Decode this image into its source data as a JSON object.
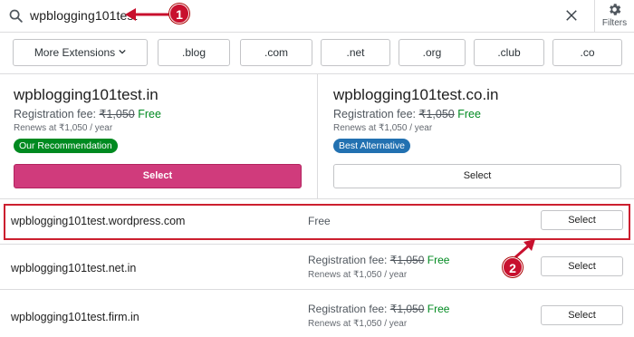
{
  "search": {
    "query": "wpblogging101test",
    "filters_label": "Filters"
  },
  "annotations": {
    "step1": "1",
    "step2": "2",
    "marker_color": "#c8102e"
  },
  "extensions": {
    "more_label": "More Extensions",
    "items": [
      ".blog",
      ".com",
      ".net",
      ".org",
      ".club",
      ".co"
    ]
  },
  "featured": [
    {
      "domain": "wpblogging101test.in",
      "fee_label": "Registration fee:",
      "old_price": "₹1,050",
      "price": "Free",
      "renews": "Renews at ₹1,050 / year",
      "badge": "Our Recommendation",
      "badge_color": "#008a20",
      "select_label": "Select",
      "select_color": "#d52c82"
    },
    {
      "domain": "wpblogging101test.co.in",
      "fee_label": "Registration fee:",
      "old_price": "₹1,050",
      "price": "Free",
      "renews": "Renews at ₹1,050 / year",
      "badge": "Best Alternative",
      "badge_color": "#2271b1",
      "select_label": "Select"
    }
  ],
  "results": [
    {
      "domain": "wpblogging101test.wordpress.com",
      "price": "Free",
      "select_label": "Select"
    },
    {
      "domain": "wpblogging101test.net.in",
      "fee_label": "Registration fee:",
      "old_price": "₹1,050",
      "price": "Free",
      "renews": "Renews at ₹1,050 / year",
      "select_label": "Select"
    },
    {
      "domain": "wpblogging101test.firm.in",
      "fee_label": "Registration fee:",
      "old_price": "₹1,050",
      "price": "Free",
      "renews": "Renews at ₹1,050 / year",
      "select_label": "Select"
    }
  ]
}
